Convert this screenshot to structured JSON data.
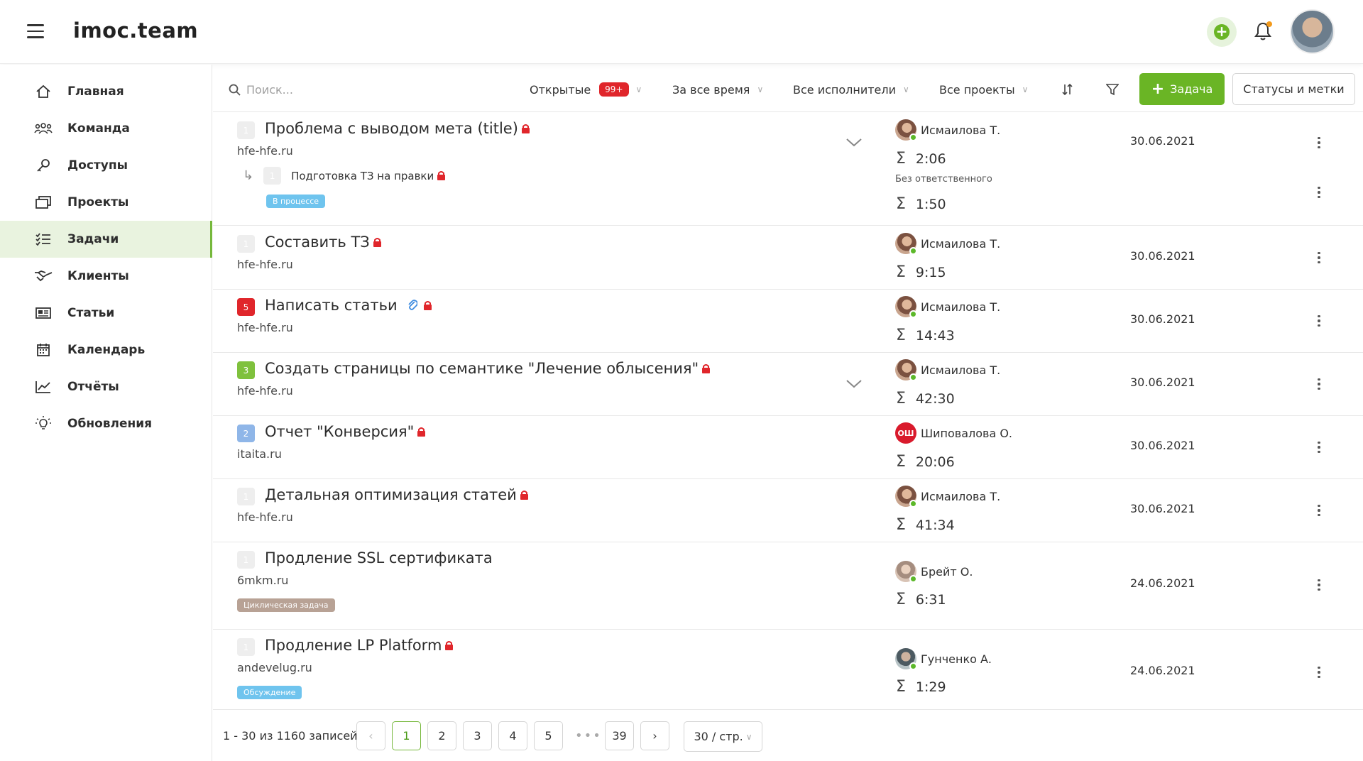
{
  "header": {
    "logo_text": "imoc.team",
    "accent_color": "#6ab525"
  },
  "sidebar": {
    "items": [
      {
        "label": "Главная",
        "icon": "home-icon"
      },
      {
        "label": "Команда",
        "icon": "team-icon"
      },
      {
        "label": "Доступы",
        "icon": "key-icon"
      },
      {
        "label": "Проекты",
        "icon": "folder-icon"
      },
      {
        "label": "Задачи",
        "icon": "tasks-icon",
        "active": true
      },
      {
        "label": "Клиенты",
        "icon": "handshake-icon"
      },
      {
        "label": "Статьи",
        "icon": "article-icon"
      },
      {
        "label": "Календарь",
        "icon": "calendar-icon"
      },
      {
        "label": "Отчёты",
        "icon": "chart-icon"
      },
      {
        "label": "Обновления",
        "icon": "bulb-icon"
      }
    ]
  },
  "toolbar": {
    "search_placeholder": "Поиск...",
    "filter_open": "Открытые",
    "open_count": "99+",
    "filter_time": "За все время",
    "filter_assignees": "Все исполнители",
    "filter_projects": "Все проекты",
    "add_task_label": "Задача",
    "statuses_label": "Статусы и метки"
  },
  "tasks": [
    {
      "priority": "1",
      "title": "Проблема с выводом мета (title)",
      "domain": "hfe-hfe.ru",
      "assignee": "Исмаилова Т.",
      "time": "2:06",
      "date": "30.06.2021",
      "subtask": {
        "priority": "1",
        "title": "Подготовка ТЗ на правки",
        "tag": "В процессе",
        "responsible": "Без ответственного",
        "time": "1:50"
      }
    },
    {
      "priority": "1",
      "title": "Составить ТЗ",
      "domain": "hfe-hfe.ru",
      "assignee": "Исмаилова Т.",
      "time": "9:15",
      "date": "30.06.2021"
    },
    {
      "priority": "5",
      "title": "Написать статьи",
      "domain": "hfe-hfe.ru",
      "assignee": "Исмаилова Т.",
      "time": "14:43",
      "date": "30.06.2021"
    },
    {
      "priority": "3",
      "title": "Создать страницы по семантике \"Лечение облысения\"",
      "domain": "hfe-hfe.ru",
      "assignee": "Исмаилова Т.",
      "time": "42:30",
      "date": "30.06.2021"
    },
    {
      "priority": "2",
      "title": "Отчет \"Конверсия\"",
      "domain": "itaita.ru",
      "assignee": "Шиповалова О.",
      "assignee_initials": "ОШ",
      "time": "20:06",
      "date": "30.06.2021"
    },
    {
      "priority": "1",
      "title": "Детальная оптимизация статей",
      "domain": "hfe-hfe.ru",
      "assignee": "Исмаилова Т.",
      "time": "41:34",
      "date": "30.06.2021"
    },
    {
      "priority": "1",
      "title": "Продление SSL сертификата",
      "domain": "6mkm.ru",
      "tag": "Циклическая задача",
      "assignee": "Брейт О.",
      "time": "6:31",
      "date": "24.06.2021"
    },
    {
      "priority": "1",
      "title": "Продление LP Platform",
      "domain": "andevelug.ru",
      "tag": "Обсуждение",
      "assignee": "Гунченко А.",
      "time": "1:29",
      "date": "24.06.2021"
    }
  ],
  "pagination": {
    "info": "1 - 30 из 1160 записей",
    "pages": [
      "1",
      "2",
      "3",
      "4",
      "5"
    ],
    "ellipsis": "•••",
    "last_page": "39",
    "current": "1",
    "per_page": "30 / стр."
  }
}
